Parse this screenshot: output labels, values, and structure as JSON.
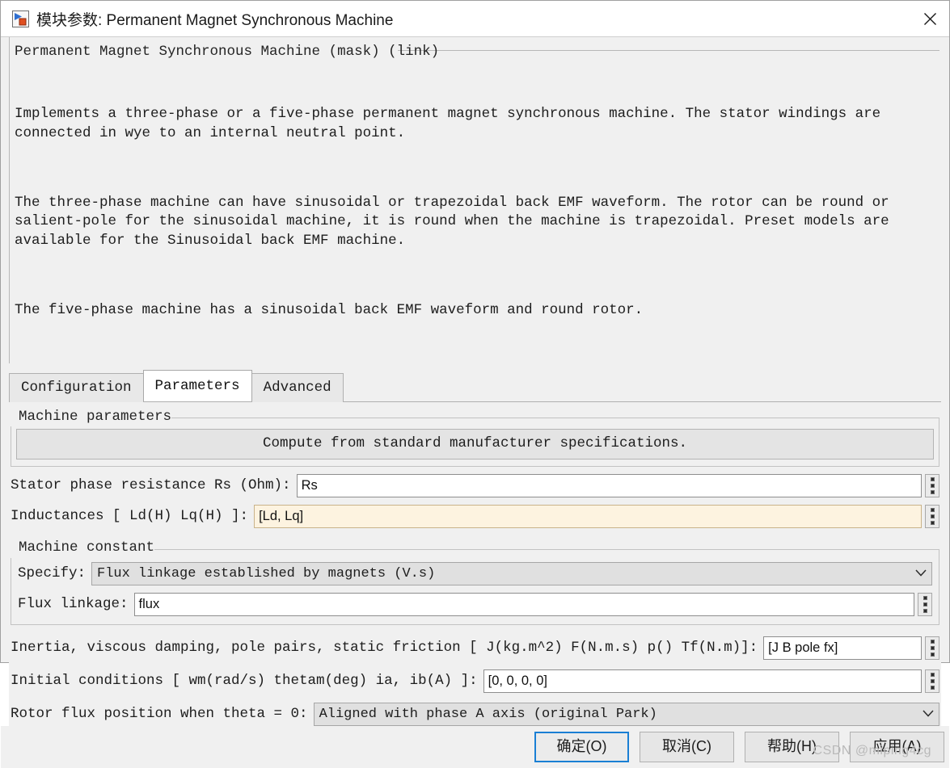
{
  "window": {
    "title": "模块参数: Permanent Magnet Synchronous Machine",
    "icon": "simulink-block-icon",
    "close_icon": "close-icon"
  },
  "description": {
    "legend": "Permanent Magnet Synchronous Machine (mask) (link)",
    "paragraphs": [
      "Implements a three-phase or a five-phase permanent magnet synchronous machine. The stator windings are connected in wye to an internal neutral point.",
      "The three-phase machine can have sinusoidal or trapezoidal back EMF waveform. The rotor can be round or salient-pole for the sinusoidal machine, it is round when the machine is trapezoidal. Preset models are available for the Sinusoidal back EMF machine.",
      "The five-phase machine has a sinusoidal back EMF waveform and round rotor."
    ]
  },
  "tabs": [
    {
      "label": "Configuration",
      "active": false
    },
    {
      "label": "Parameters",
      "active": true
    },
    {
      "label": "Advanced",
      "active": false
    }
  ],
  "machine_parameters": {
    "group_label": "Machine parameters",
    "compute_button": "Compute from standard manufacturer specifications.",
    "stator_resistance": {
      "label": "Stator phase resistance Rs (Ohm):",
      "value": "Rs",
      "spinner_icon": "vertical-dots-icon"
    },
    "inductances": {
      "label": "Inductances [ Ld(H)  Lq(H) ]:",
      "value": "[Ld, Lq]",
      "focused": true,
      "spinner_icon": "vertical-dots-icon"
    }
  },
  "machine_constant": {
    "group_label": "Machine constant",
    "specify": {
      "label": "Specify:",
      "value": "Flux linkage established by magnets (V.s)",
      "caret_icon": "chevron-down-icon"
    },
    "flux_linkage": {
      "label": "Flux linkage:",
      "value": "flux",
      "spinner_icon": "vertical-dots-icon"
    }
  },
  "mechanical": {
    "inertia": {
      "label": "Inertia, viscous damping, pole pairs, static friction [ J(kg.m^2)  F(N.m.s)  p()  Tf(N.m)]:",
      "value": "[J B pole fx]",
      "spinner_icon": "vertical-dots-icon"
    },
    "initial_conditions": {
      "label": "Initial conditions [ wm(rad/s)  thetam(deg)  ia, ib(A) ]:",
      "value": "[0, 0,  0, 0]",
      "spinner_icon": "vertical-dots-icon"
    },
    "rotor_flux_position": {
      "label": "Rotor flux position when theta = 0:",
      "value": "Aligned with phase A axis (original Park)",
      "caret_icon": "chevron-down-icon"
    }
  },
  "footer": {
    "buttons": [
      {
        "label": "确定(O)",
        "name": "ok-button",
        "default": true
      },
      {
        "label": "取消(C)",
        "name": "cancel-button",
        "default": false
      },
      {
        "label": "帮助(H)",
        "name": "help-button",
        "default": false
      },
      {
        "label": "应用(A)",
        "name": "apply-button",
        "default": false
      }
    ],
    "watermark": "CSDN @miping4cg"
  },
  "colors": {
    "accent": "#1a7fd4",
    "focus_field_bg": "#fdf3e0",
    "dialog_bg": "#f0f0f0"
  }
}
